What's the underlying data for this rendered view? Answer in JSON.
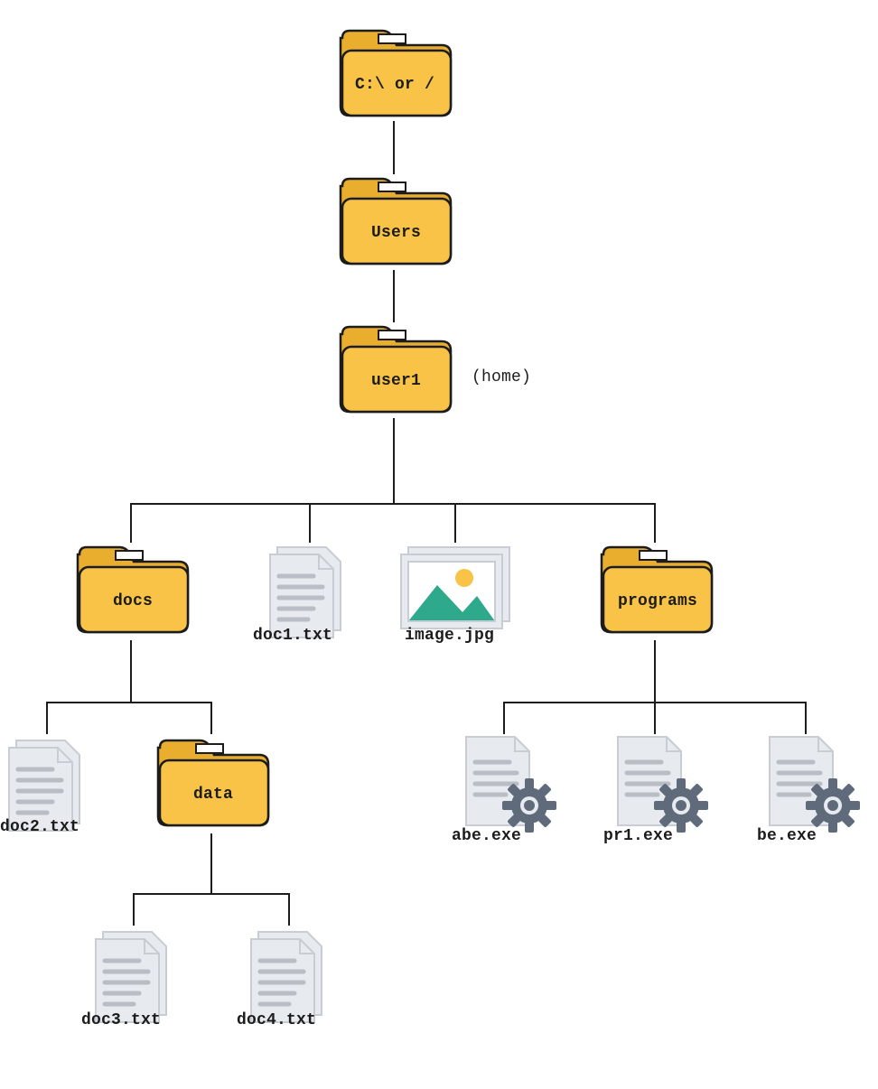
{
  "nodes": {
    "root": {
      "label": "C:\\ or /"
    },
    "users": {
      "label": "Users"
    },
    "user1": {
      "label": "user1",
      "annotation": "(home)"
    },
    "docs": {
      "label": "docs"
    },
    "doc1": {
      "label": "doc1.txt"
    },
    "image": {
      "label": "image.jpg"
    },
    "programs": {
      "label": "programs"
    },
    "doc2": {
      "label": "doc2.txt"
    },
    "data": {
      "label": "data"
    },
    "doc3": {
      "label": "doc3.txt"
    },
    "doc4": {
      "label": "doc4.txt"
    },
    "abe": {
      "label": "abe.exe"
    },
    "pr1": {
      "label": "pr1.exe"
    },
    "be": {
      "label": "be.exe"
    }
  },
  "colors": {
    "folder_main": "#f8c346",
    "folder_tab": "#e9ae2d",
    "folder_stroke": "#1c1c1c",
    "doc_fill": "#e7eaee",
    "doc_stroke": "#c8cdd4",
    "doc_line": "#b9bec6",
    "img_border": "#e7eaee",
    "img_sky": "#ffffff",
    "img_sun": "#f8c346",
    "img_hill": "#2fa98c",
    "gear": "#5f6b7a",
    "line": "#1c1c1c"
  }
}
